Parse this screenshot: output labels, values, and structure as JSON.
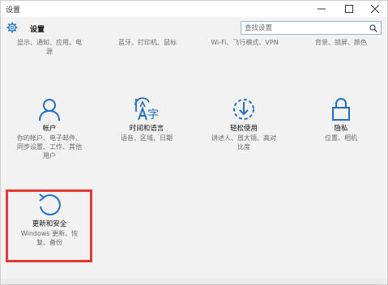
{
  "window": {
    "title": "设置"
  },
  "header": {
    "settings_label": "设置"
  },
  "search": {
    "placeholder": "查找设置"
  },
  "top_row": [
    {
      "text": "显示、通知、应用、电\n源"
    },
    {
      "text": "蓝牙、打印机、鼠标"
    },
    {
      "text": "Wi-Fi、飞行模式、VPN"
    },
    {
      "text": "背景、锁屏、颜色"
    }
  ],
  "tiles": [
    {
      "name": "帐户",
      "desc": "你的帐户、电子邮件、\n同步设置、工作、其他\n用户",
      "icon": "person-icon"
    },
    {
      "name": "时间和语言",
      "desc": "语音、区域、日期",
      "icon": "time-language-icon"
    },
    {
      "name": "轻松使用",
      "desc": "讲述人、放大镜、高对\n比度",
      "icon": "ease-of-access-icon"
    },
    {
      "name": "隐私",
      "desc": "位置、相机",
      "icon": "lock-icon"
    },
    {
      "name": "更新和安全",
      "desc": "Windows 更新、恢\n复、备份",
      "icon": "refresh-icon"
    }
  ],
  "colors": {
    "accent": "#1f6fc8",
    "highlight": "#e53935"
  }
}
